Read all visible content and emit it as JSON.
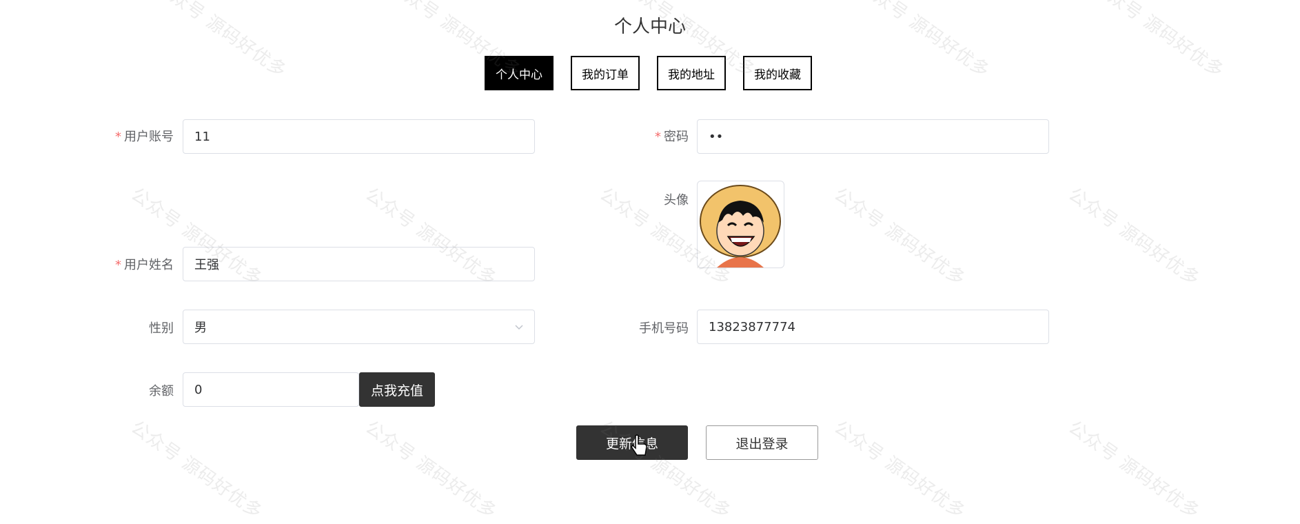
{
  "page": {
    "title": "个人中心"
  },
  "tabs": [
    {
      "label": "个人中心",
      "active": true
    },
    {
      "label": "我的订单",
      "active": false
    },
    {
      "label": "我的地址",
      "active": false
    },
    {
      "label": "我的收藏",
      "active": false
    }
  ],
  "form": {
    "account": {
      "label": "用户账号",
      "value": "11",
      "required": "*"
    },
    "password": {
      "label": "密码",
      "value": "••",
      "required": "*"
    },
    "avatar": {
      "label": "头像"
    },
    "name": {
      "label": "用户姓名",
      "value": "王强",
      "required": "*"
    },
    "gender": {
      "label": "性别",
      "value": "男"
    },
    "phone": {
      "label": "手机号码",
      "value": "13823877774"
    },
    "balance": {
      "label": "余额",
      "value": "0"
    }
  },
  "buttons": {
    "recharge": "点我充值",
    "update": "更新信息",
    "logout": "退出登录"
  },
  "watermark": {
    "text": "公众号 源码好优多"
  },
  "colors": {
    "required": "#f56c6c",
    "dark": "#333333",
    "active_tab": "#000000"
  }
}
